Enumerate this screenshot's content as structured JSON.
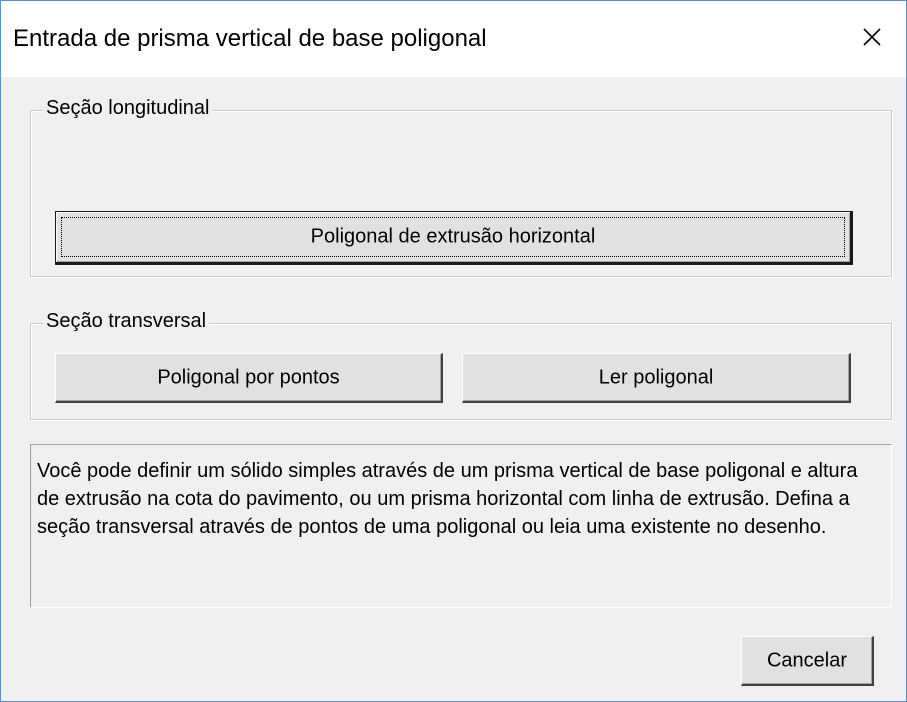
{
  "window": {
    "title": "Entrada de prisma vertical de base poligonal",
    "close_icon": "close-icon"
  },
  "longitudinal": {
    "legend": "Seção longitudinal",
    "extrusion_button": "Poligonal de extrusão horizontal"
  },
  "transversal": {
    "legend": "Seção transversal",
    "points_button": "Poligonal por pontos",
    "read_button": "Ler poligonal"
  },
  "info": {
    "text": "Você pode definir um sólido simples através de um prisma vertical de base poligonal e altura de extrusão na cota do pavimento, ou um prisma horizontal com linha de extrusão. Defina a seção transversal através de pontos de uma poligonal ou leia uma existente no desenho."
  },
  "footer": {
    "cancel_button": "Cancelar"
  },
  "colors": {
    "window_border": "#5a8fcc",
    "dialog_background": "#f0f0f0",
    "button_face": "#e1e1e1"
  }
}
